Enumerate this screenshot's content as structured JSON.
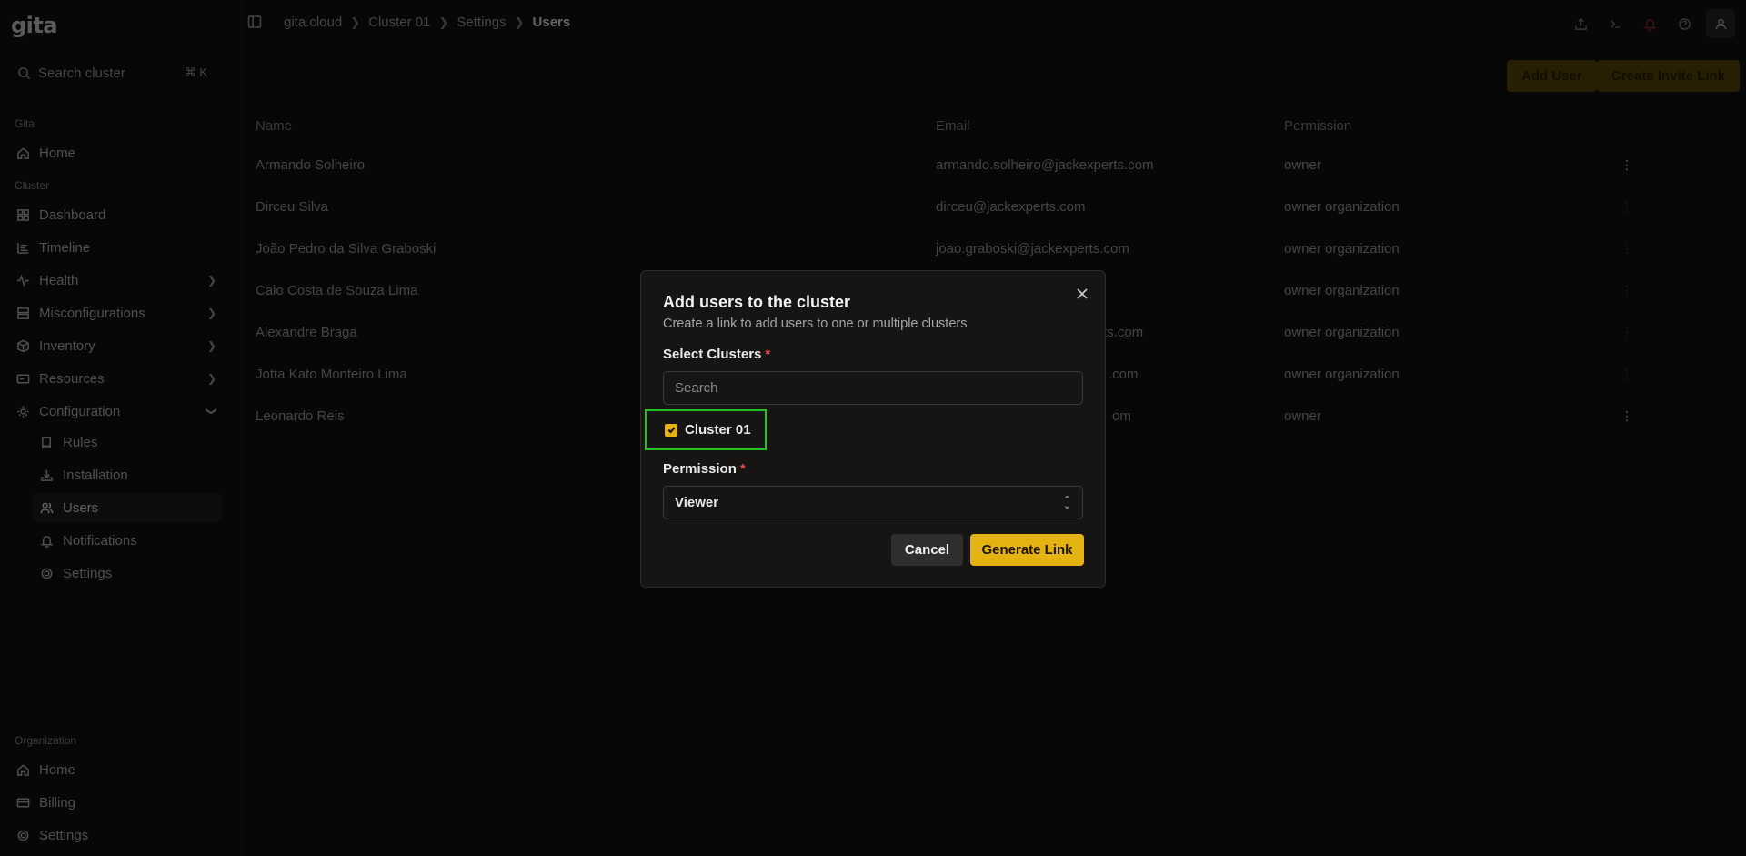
{
  "app": {
    "logo": "gita"
  },
  "sidebar": {
    "search_placeholder": "Search cluster",
    "search_shortcut": "⌘ K",
    "gita_label": "Gita",
    "home": "Home",
    "cluster_label": "Cluster",
    "cluster_items": [
      {
        "label": "Dashboard",
        "icon": "dashboard-icon"
      },
      {
        "label": "Timeline",
        "icon": "timeline-icon"
      },
      {
        "label": "Health",
        "icon": "health-icon"
      },
      {
        "label": "Misconfigurations",
        "icon": "misconfigurations-icon"
      },
      {
        "label": "Inventory",
        "icon": "inventory-icon"
      },
      {
        "label": "Resources",
        "icon": "resources-icon"
      },
      {
        "label": "Configuration",
        "icon": "configuration-icon"
      }
    ],
    "configuration_sub": [
      {
        "label": "Rules",
        "icon": "book-icon"
      },
      {
        "label": "Installation",
        "icon": "installation-icon"
      },
      {
        "label": "Users",
        "icon": "users-icon"
      },
      {
        "label": "Notifications",
        "icon": "bell-icon"
      },
      {
        "label": "Settings",
        "icon": "gear-icon"
      }
    ],
    "organization_label": "Organization",
    "organization_items": [
      {
        "label": "Home",
        "icon": "home-icon"
      },
      {
        "label": "Billing",
        "icon": "billing-icon"
      },
      {
        "label": "Settings",
        "icon": "gear-icon"
      }
    ]
  },
  "breadcrumb": [
    "gita.cloud",
    "Cluster 01",
    "Settings",
    "Users"
  ],
  "actions": {
    "add_user": "Add User",
    "create_invite_link": "Create Invite Link"
  },
  "table": {
    "headers": {
      "name": "Name",
      "email": "Email",
      "permission": "Permission"
    },
    "rows": [
      {
        "name": "Armando Solheiro",
        "email": "armando.solheiro@jackexperts.com",
        "permission": "owner"
      },
      {
        "name": "Dirceu Silva",
        "email": "dirceu@jackexperts.com",
        "permission": "owner organization"
      },
      {
        "name": "João Pedro da Silva Graboski",
        "email": "joao.graboski@jackexperts.com",
        "permission": "owner organization"
      },
      {
        "name": "Caio Costa de Souza Lima",
        "email": "",
        "permission": "owner organization"
      },
      {
        "name": "Alexandre Braga",
        "email": "rts.com",
        "permission": "owner organization"
      },
      {
        "name": "Jotta Kato Monteiro Lima",
        "email": ".com",
        "permission": "owner organization"
      },
      {
        "name": "Leonardo Reis",
        "email": "om",
        "permission": "owner"
      }
    ]
  },
  "modal": {
    "title": "Add users to the cluster",
    "subtitle": "Create a link to add users to one or multiple clusters",
    "select_clusters_label": "Select Clusters",
    "required_mark": "*",
    "search_placeholder": "Search",
    "cluster_option": "Cluster 01",
    "cluster_checked": true,
    "permission_label": "Permission",
    "permission_value": "Viewer",
    "cancel": "Cancel",
    "generate": "Generate Link"
  },
  "colors": {
    "accent": "#e5b311",
    "highlight": "#21c21f",
    "danger": "#e5484d"
  }
}
